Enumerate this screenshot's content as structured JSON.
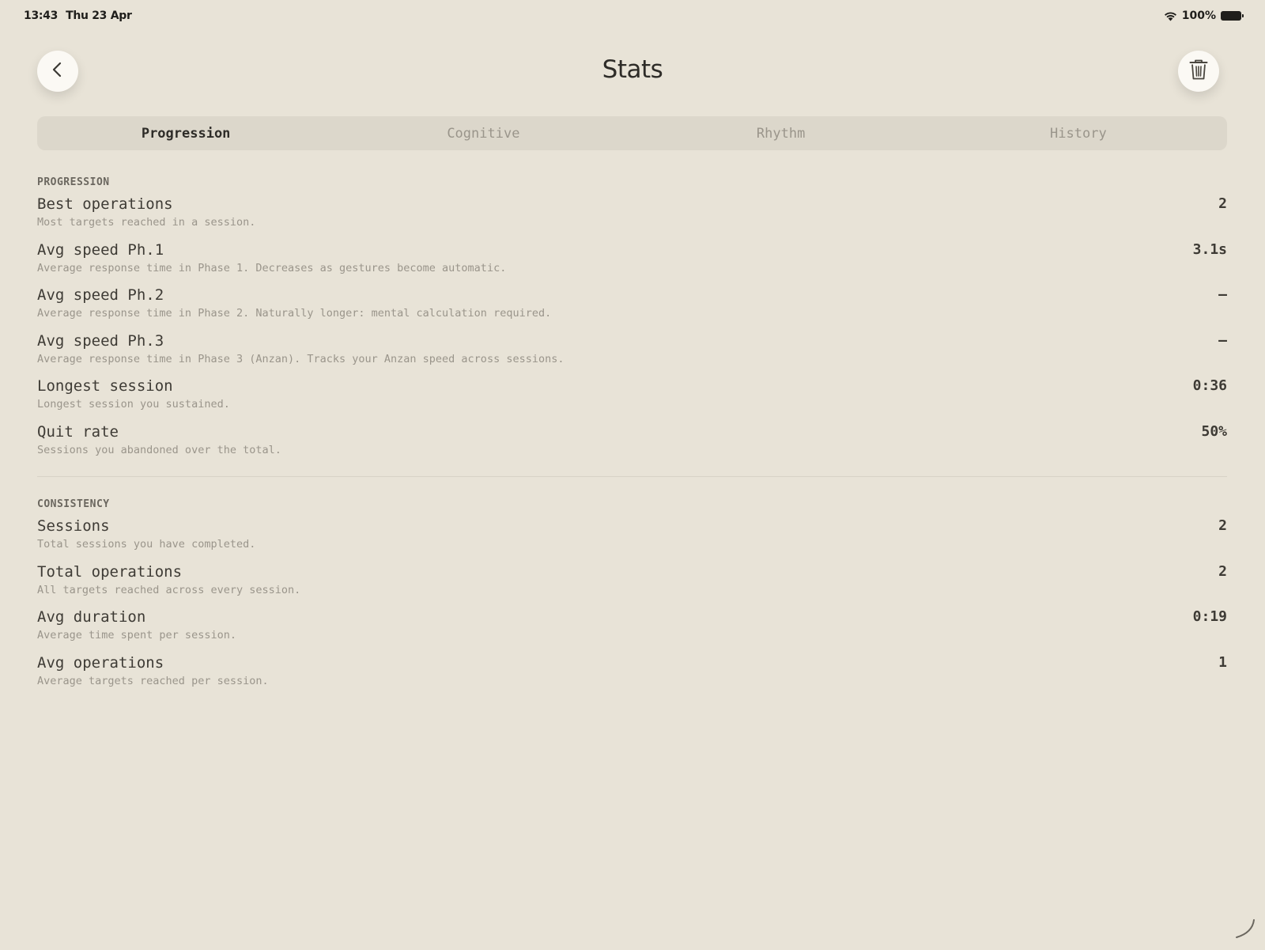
{
  "status_bar": {
    "time": "13:43",
    "date": "Thu 23 Apr",
    "battery": "100%"
  },
  "header": {
    "title": "Stats",
    "back_icon": "chevron-left-icon",
    "delete_icon": "trash-icon"
  },
  "tabs": [
    {
      "label": "Progression",
      "active": true
    },
    {
      "label": "Cognitive",
      "active": false
    },
    {
      "label": "Rhythm",
      "active": false
    },
    {
      "label": "History",
      "active": false
    }
  ],
  "sections": {
    "progression": {
      "title": "PROGRESSION",
      "items": [
        {
          "label": "Best operations",
          "desc": "Most targets reached in a session.",
          "value": "2"
        },
        {
          "label": "Avg speed Ph.1",
          "desc": "Average response time in Phase 1. Decreases as gestures become automatic.",
          "value": "3.1s"
        },
        {
          "label": "Avg speed Ph.2",
          "desc": "Average response time in Phase 2. Naturally longer: mental calculation required.",
          "value": "–"
        },
        {
          "label": "Avg speed Ph.3",
          "desc": "Average response time in Phase 3 (Anzan). Tracks your Anzan speed across sessions.",
          "value": "–"
        },
        {
          "label": "Longest session",
          "desc": "Longest session you sustained.",
          "value": "0:36"
        },
        {
          "label": "Quit rate",
          "desc": "Sessions you abandoned over the total.",
          "value": "50%"
        }
      ]
    },
    "consistency": {
      "title": "CONSISTENCY",
      "items": [
        {
          "label": "Sessions",
          "desc": "Total sessions you have completed.",
          "value": "2"
        },
        {
          "label": "Total operations",
          "desc": "All targets reached across every session.",
          "value": "2"
        },
        {
          "label": "Avg duration",
          "desc": "Average time spent per session.",
          "value": "0:19"
        },
        {
          "label": "Avg operations",
          "desc": "Average targets reached per session.",
          "value": "1"
        }
      ]
    }
  },
  "colors": {
    "background": "#e8e3d7",
    "tab_bar": "#dcd7cb",
    "text_primary": "#3e3b35",
    "text_muted": "#9a958b"
  }
}
